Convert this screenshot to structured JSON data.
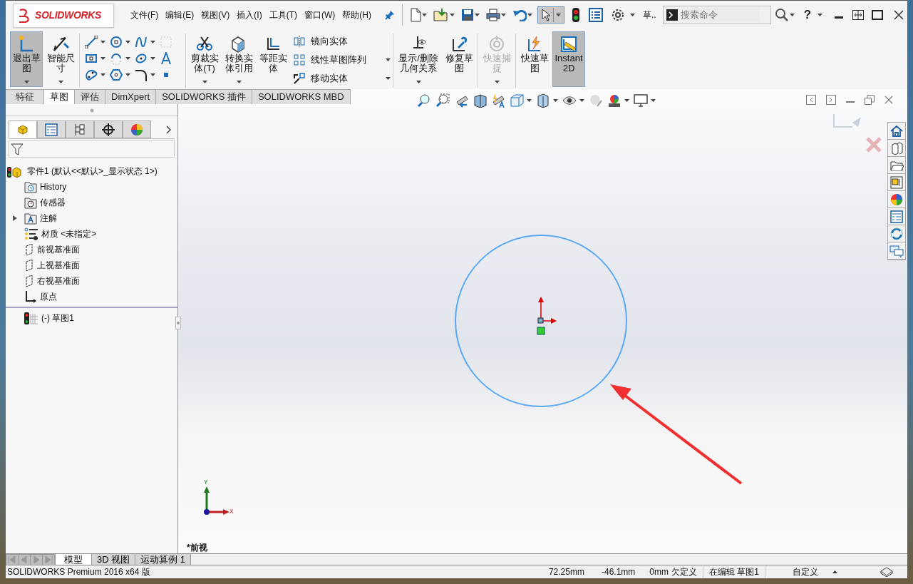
{
  "logo": {
    "text": "SOLIDWORKS"
  },
  "menu": [
    "文件(F)",
    "编辑(E)",
    "视图(V)",
    "插入(I)",
    "工具(T)",
    "窗口(W)",
    "帮助(H)"
  ],
  "quick_access": {
    "truncated_label": "草..",
    "search_placeholder": "搜索命令",
    "help": "?"
  },
  "ribbon": {
    "groups": [
      {
        "buttons": [
          {
            "kind": "big",
            "label": "退出草图",
            "pressed": true,
            "disabled": false,
            "dropdown": true
          },
          {
            "kind": "big",
            "label": "智能尺寸",
            "pressed": false,
            "disabled": false,
            "dropdown": true
          }
        ]
      },
      {
        "buttons": [
          {
            "kind": "tool_grid"
          }
        ]
      },
      {
        "buttons": [
          {
            "kind": "big",
            "label": "剪裁实体(T)",
            "pressed": false,
            "disabled": false,
            "dropdown": true
          },
          {
            "kind": "big",
            "label": "转换实体引用",
            "pressed": false,
            "disabled": false,
            "dropdown": true
          },
          {
            "kind": "big",
            "label": "等距实体",
            "pressed": false,
            "disabled": false,
            "dropdown": false
          },
          {
            "kind": "small",
            "label": "镜向实体",
            "dropdown": false
          },
          {
            "kind": "small",
            "label": "线性草图阵列",
            "dropdown": true
          },
          {
            "kind": "small",
            "label": "移动实体",
            "dropdown": true
          }
        ]
      },
      {
        "buttons": [
          {
            "kind": "big_wide",
            "label": "显示/删除几何关系",
            "pressed": false,
            "disabled": false,
            "dropdown": true
          },
          {
            "kind": "big",
            "label": "修复草图",
            "pressed": false,
            "disabled": false,
            "dropdown": false
          }
        ]
      },
      {
        "buttons": [
          {
            "kind": "big",
            "label": "快速捕捉",
            "pressed": false,
            "disabled": true,
            "dropdown": true
          }
        ]
      },
      {
        "buttons": [
          {
            "kind": "big",
            "label": "快速草图",
            "pressed": false,
            "disabled": false,
            "dropdown": false
          },
          {
            "kind": "big",
            "label": "Instant2D",
            "pressed": true,
            "disabled": false,
            "dropdown": false
          }
        ]
      }
    ]
  },
  "command_tabs": [
    {
      "label": "特征",
      "selected": false
    },
    {
      "label": "草图",
      "selected": true
    },
    {
      "label": "评估",
      "selected": false
    },
    {
      "label": "DimXpert",
      "selected": false
    },
    {
      "label": "SOLIDWORKS 插件",
      "selected": false
    },
    {
      "label": "SOLIDWORKS MBD",
      "selected": false
    }
  ],
  "panel_tabs": [
    {
      "selected": true
    },
    {
      "selected": false
    },
    {
      "selected": false
    },
    {
      "selected": false
    },
    {
      "selected": false
    }
  ],
  "tree": [
    {
      "kind": "part",
      "label": "零件1  (默认<<默认>_显示状态 1>)",
      "children": [
        {
          "kind": "history",
          "label": "History"
        },
        {
          "kind": "sensor",
          "label": "传感器"
        },
        {
          "kind": "annotation",
          "label": "注解",
          "expanded": false
        },
        {
          "kind": "material",
          "label": "材质 <未指定>"
        },
        {
          "kind": "plane",
          "label": "前视基准面"
        },
        {
          "kind": "plane",
          "label": "上视基准面"
        },
        {
          "kind": "plane",
          "label": "右视基准面"
        },
        {
          "kind": "origin",
          "label": "原点"
        },
        {
          "kind": "sketch",
          "label": "(-) 草图1"
        }
      ]
    }
  ],
  "graphics": {
    "view_label": "*前视",
    "triad": {
      "y_label": "Y",
      "x_label": "X"
    }
  },
  "bottom_tabs": [
    {
      "label": "模型",
      "selected": true
    },
    {
      "label": "3D 视图",
      "selected": false
    },
    {
      "label": "运动算例 1",
      "selected": false
    }
  ],
  "status_bar": {
    "product": "SOLIDWORKS Premium 2016 x64 版",
    "x": "72.25mm",
    "y": "-46.1mm",
    "z": "0mm",
    "state": "欠定义",
    "editing": "在编辑 草图1",
    "units": "自定义"
  }
}
